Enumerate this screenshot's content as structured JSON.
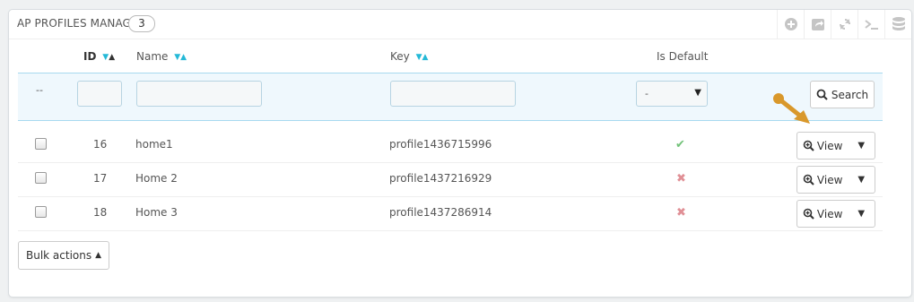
{
  "panel": {
    "title": "AP PROFILES MANAGE",
    "count": "3",
    "toolbar": [
      {
        "icon": "add-new-icon"
      },
      {
        "icon": "export-icon"
      },
      {
        "icon": "refresh-icon"
      },
      {
        "icon": "sql-query-icon"
      },
      {
        "icon": "database-icon"
      }
    ]
  },
  "table": {
    "headers": {
      "id": "ID",
      "name": "Name",
      "key": "Key",
      "is_default": "Is Default"
    },
    "filters": {
      "dash": "--",
      "id_value": "",
      "name_value": "",
      "key_value": "",
      "is_default_value": "-",
      "search_label": "Search"
    },
    "rows": [
      {
        "id": "16",
        "name": "home1",
        "key": "profile1436715996",
        "is_default": true,
        "action": "View"
      },
      {
        "id": "17",
        "name": "Home 2",
        "key": "profile1437216929",
        "is_default": false,
        "action": "View"
      },
      {
        "id": "18",
        "name": "Home 3",
        "key": "profile1437286914",
        "is_default": false,
        "action": "View"
      }
    ]
  },
  "footer": {
    "bulk_actions_label": "Bulk actions"
  },
  "colors": {
    "accent": "#25b9d7",
    "pointer": "#d9982b",
    "check": "#72c279",
    "cross": "#e08f95"
  }
}
